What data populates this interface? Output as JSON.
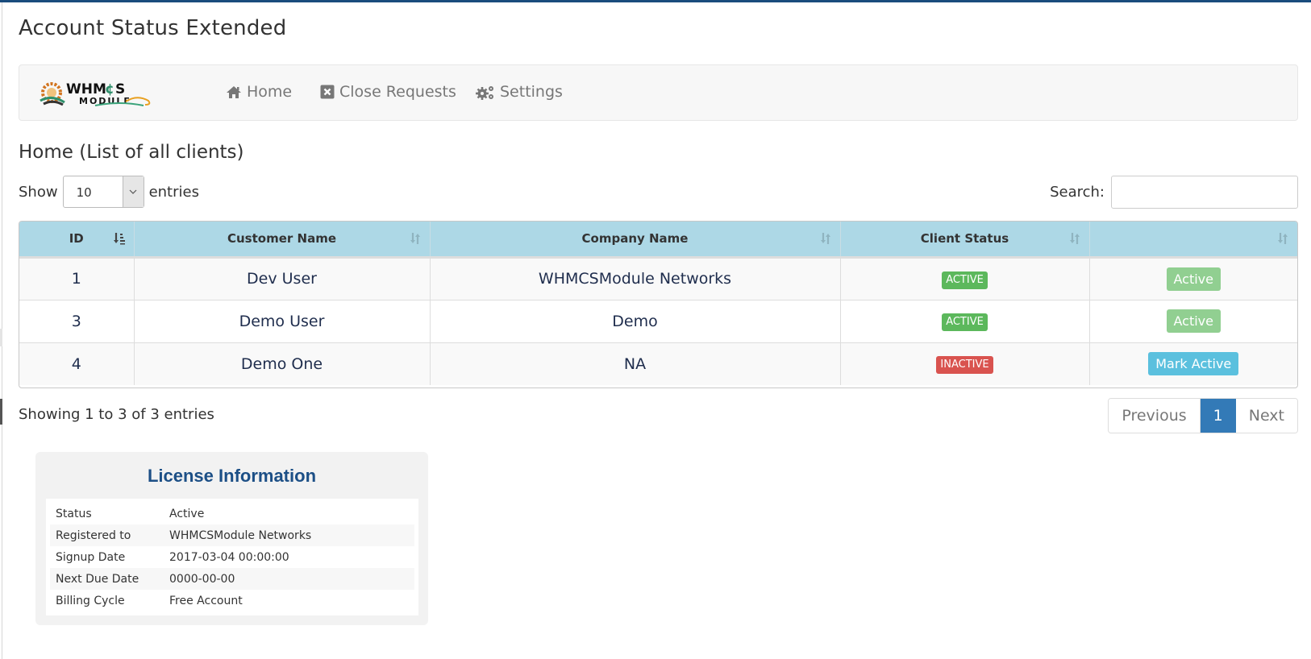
{
  "page": {
    "title": "Account Status Extended"
  },
  "navbar": {
    "logo_alt": "WHMCS Module",
    "items": [
      {
        "label": "Home",
        "icon": "home-icon"
      },
      {
        "label": "Close Requests",
        "icon": "close-square-icon"
      },
      {
        "label": "Settings",
        "icon": "gears-icon"
      }
    ]
  },
  "section": {
    "title": "Home (List of all clients)"
  },
  "length_control": {
    "show_label": "Show",
    "selected": "10",
    "entries_label": "entries"
  },
  "search": {
    "label": "Search:",
    "value": "",
    "placeholder": ""
  },
  "table": {
    "columns": [
      {
        "label": "ID",
        "sort": "ascending"
      },
      {
        "label": "Customer Name",
        "sort": "both"
      },
      {
        "label": "Company Name",
        "sort": "both"
      },
      {
        "label": "Client Status",
        "sort": "both"
      },
      {
        "label": "",
        "sort": "both"
      }
    ],
    "rows": [
      {
        "id": "1",
        "customer": "Dev User",
        "company": "WHMCSModule Networks",
        "status": "ACTIVE",
        "status_color": "#5cb85c",
        "action": "Active",
        "action_color": "#91cf91",
        "action_disabled": true
      },
      {
        "id": "3",
        "customer": "Demo User",
        "company": "Demo",
        "status": "ACTIVE",
        "status_color": "#5cb85c",
        "action": "Active",
        "action_color": "#91cf91",
        "action_disabled": true
      },
      {
        "id": "4",
        "customer": "Demo One",
        "company": "NA",
        "status": "INACTIVE",
        "status_color": "#d9534f",
        "action": "Mark Active",
        "action_color": "#5bc0de",
        "action_disabled": false
      }
    ]
  },
  "footer": {
    "info": "Showing 1 to 3 of 3 entries",
    "pagination": {
      "previous": "Previous",
      "current": "1",
      "next": "Next"
    }
  },
  "license": {
    "title": "License Information",
    "rows": [
      {
        "key": "Status",
        "value": "Active"
      },
      {
        "key": "Registered to",
        "value": "WHMCSModule Networks"
      },
      {
        "key": "Signup Date",
        "value": "2017-03-04 00:00:00"
      },
      {
        "key": "Next Due Date",
        "value": "0000-00-00"
      },
      {
        "key": "Billing Cycle",
        "value": "Free Account"
      }
    ]
  },
  "colors": {
    "top_bar": "#1a4c7d",
    "table_header": "#add8e6",
    "pagination_active": "#337ab7",
    "license_title": "#1c4f86"
  }
}
